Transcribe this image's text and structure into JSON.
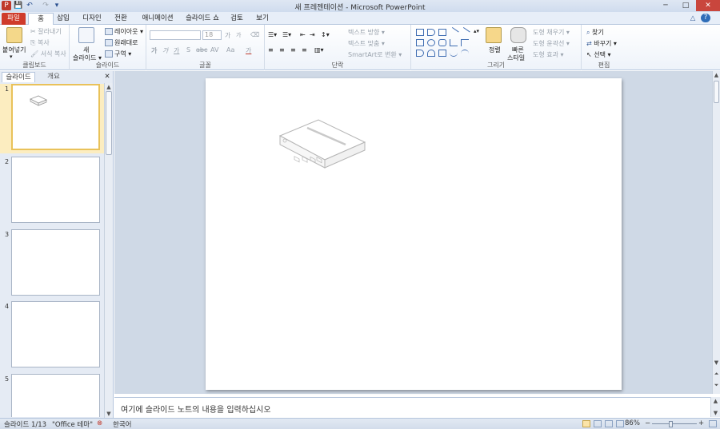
{
  "window": {
    "title": "새 프레젠테이션 - Microsoft PowerPoint",
    "minimize": "─",
    "maximize": "□",
    "close": "✕"
  },
  "quick_access": {
    "save": "💾",
    "undo": "↶",
    "redo": "↷",
    "customize": "▾"
  },
  "tabs": [
    {
      "label": "파일"
    },
    {
      "label": "홈"
    },
    {
      "label": "삽입"
    },
    {
      "label": "디자인"
    },
    {
      "label": "전환"
    },
    {
      "label": "애니메이션"
    },
    {
      "label": "슬라이드 쇼"
    },
    {
      "label": "검토"
    },
    {
      "label": "보기"
    }
  ],
  "ribbon": {
    "clipboard": {
      "label": "클립보드",
      "paste": "붙여넣기",
      "cut": "잘라내기",
      "copy": "복사",
      "format_painter": "서식 복사"
    },
    "slides": {
      "label": "슬라이드",
      "new_slide_1": "새",
      "new_slide_2": "슬라이드 ▾",
      "layout": "레이아웃 ▾",
      "reset": "원래대로",
      "section": "구역 ▾"
    },
    "font": {
      "label": "글꼴",
      "font_name": "",
      "font_size": "18",
      "grow": "가",
      "shrink": "가",
      "clear": "⌫",
      "bold": "가",
      "italic": "가",
      "underline": "가",
      "strike": "S",
      "abc": "abc",
      "spacing": "AV",
      "case": "Aa",
      "color": "가"
    },
    "paragraph": {
      "label": "단락",
      "text_direction": "텍스트 방향 ▾",
      "align_text": "텍스트 맞춤 ▾",
      "smartart": "SmartArt로 변환 ▾"
    },
    "drawing": {
      "label": "그리기",
      "arrange": "정렬",
      "quick_styles_1": "빠른",
      "quick_styles_2": "스타일",
      "shape_fill": "도형 채우기 ▾",
      "shape_outline": "도형 윤곽선 ▾",
      "shape_effects": "도형 효과 ▾"
    },
    "editing": {
      "label": "편집",
      "find": "찾기",
      "replace": "바꾸기 ▾",
      "select": "선택 ▾"
    }
  },
  "left_panel": {
    "tab_slides": "슬라이드",
    "tab_outline": "개요",
    "close": "✕",
    "thumbnails": [
      {
        "number": "1"
      },
      {
        "number": "2"
      },
      {
        "number": "3"
      },
      {
        "number": "4"
      },
      {
        "number": "5"
      }
    ]
  },
  "notes": {
    "placeholder": "여기에 슬라이드 노트의 내용을 입력하십시오"
  },
  "statusbar": {
    "slide_position": "슬라이드 1/13",
    "theme": "\"Office 테마\"",
    "language": "한국어",
    "zoom": "86%",
    "zoom_out": "−",
    "zoom_in": "+"
  },
  "colors": {
    "file_tab": "#cf3b2b",
    "title_bar": "#dfe7f3",
    "ribbon_bg": "#eef3fa",
    "editor_bg": "#cfd9e6",
    "selection": "#e9c25a"
  }
}
